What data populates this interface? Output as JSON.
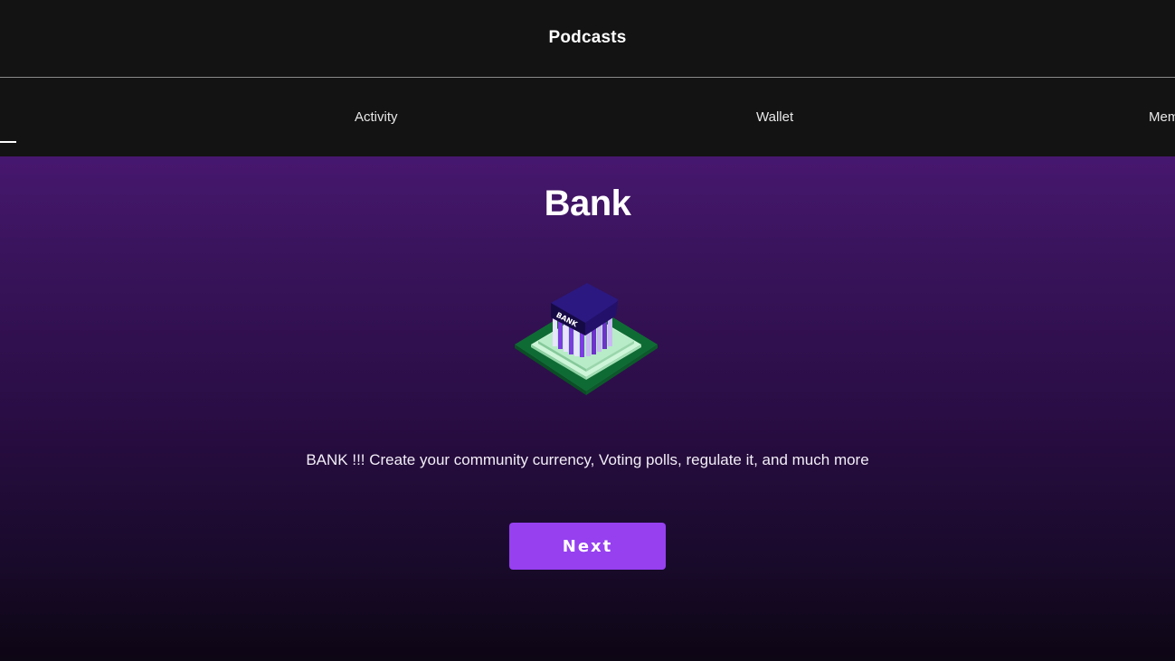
{
  "header": {
    "title": "Podcasts"
  },
  "tabs": [
    {
      "label": "Activity"
    },
    {
      "label": "Wallet"
    },
    {
      "label": "Mem"
    }
  ],
  "hero": {
    "title": "Bank",
    "illustration_text": "BANK",
    "illustration_icon": "bank-building-icon",
    "description": "BANK !!! Create your community currency, Voting polls, regulate it, and much more",
    "next_label": "Next"
  },
  "colors": {
    "top_background": "#131313",
    "gradient_top": "#47176f",
    "gradient_bottom": "#0d0614",
    "button": "#9640f0",
    "bank_roof": "#1c0d58",
    "bank_base": "#0f6b34",
    "bank_steps": "#b8ecc8"
  }
}
